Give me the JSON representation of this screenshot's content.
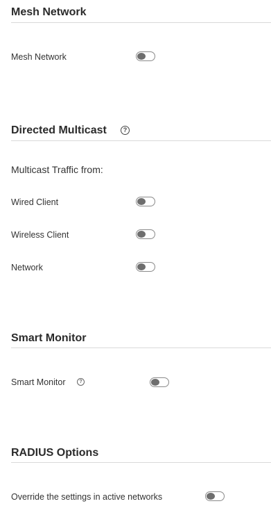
{
  "mesh": {
    "title": "Mesh Network",
    "toggle_label": "Mesh Network",
    "toggle_on": false
  },
  "multicast": {
    "title": "Directed Multicast",
    "help_icon": "question-circle",
    "traffic_from_label": "Multicast Traffic from:",
    "items": [
      {
        "label": "Wired Client",
        "on": false
      },
      {
        "label": "Wireless Client",
        "on": false
      },
      {
        "label": "Network",
        "on": false
      }
    ]
  },
  "smart_monitor": {
    "title": "Smart Monitor",
    "toggle_label": "Smart Monitor",
    "help_icon": "question-circle",
    "toggle_on": false
  },
  "radius": {
    "title": "RADIUS Options",
    "toggle_label": "Override the settings in active networks",
    "toggle_on": false
  },
  "colors": {
    "toggle_border": "#8a8a8a",
    "toggle_knob": "#6e6e6e",
    "divider": "#d9d9d9"
  }
}
